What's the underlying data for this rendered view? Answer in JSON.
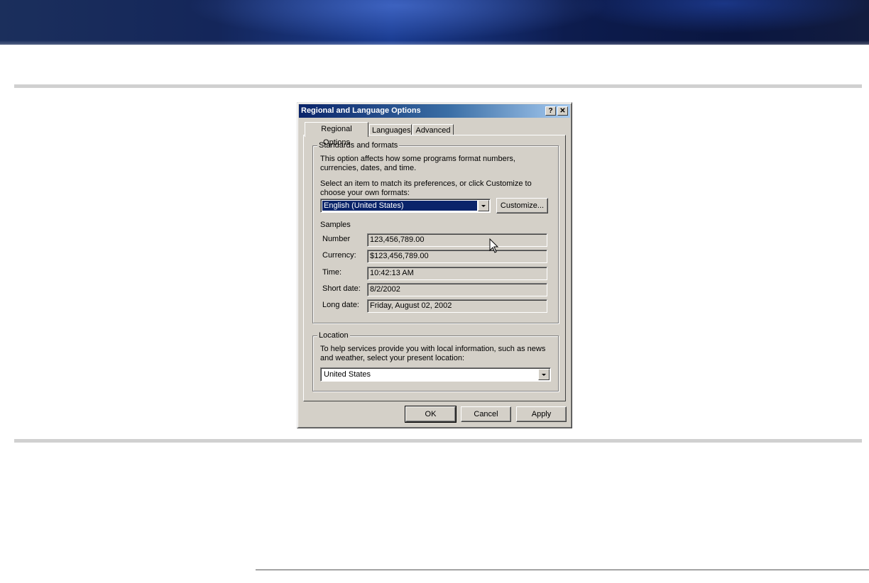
{
  "dialog": {
    "title": "Regional and Language Options",
    "help_glyph": "?",
    "close_glyph": "✕",
    "tabs": [
      {
        "label": "Regional Options"
      },
      {
        "label": "Languages"
      },
      {
        "label": "Advanced"
      }
    ],
    "standards": {
      "legend": "Standards and formats",
      "description": "This option affects how some programs format numbers, currencies, dates, and time.",
      "instruction": "Select an item to match its preferences, or click Customize to choose your own formats:",
      "selected_format": "English (United States)",
      "customize_label": "Customize...",
      "samples_heading": "Samples",
      "samples": [
        {
          "label": "Number",
          "value": "123,456,789.00"
        },
        {
          "label": "Currency:",
          "value": "$123,456,789.00"
        },
        {
          "label": "Time:",
          "value": "10:42:13 AM"
        },
        {
          "label": "Short date:",
          "value": "8/2/2002"
        },
        {
          "label": "Long date:",
          "value": "Friday, August 02, 2002"
        }
      ]
    },
    "location": {
      "legend": "Location",
      "description": "To help services provide you with local information, such as news and weather, select your present location:",
      "selected_location": "United States"
    },
    "buttons": {
      "ok": "OK",
      "cancel": "Cancel",
      "apply": "Apply"
    }
  }
}
